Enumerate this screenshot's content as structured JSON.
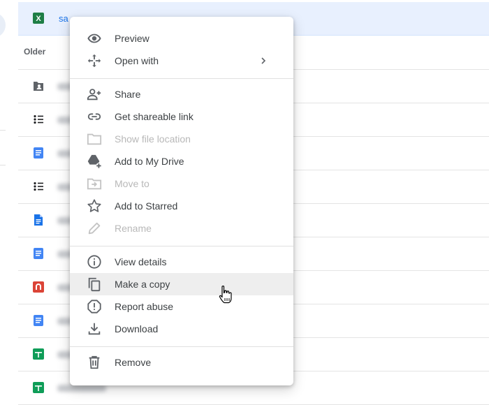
{
  "file_list": {
    "selected_row": {
      "name": "sa",
      "icon": "excel-icon",
      "icon_letter": "X",
      "color": "#1e7e45"
    },
    "section_label": "Older",
    "rows": [
      {
        "icon": "shared-folder-icon"
      },
      {
        "icon": "list-doc-icon"
      },
      {
        "icon": "google-docs-icon"
      },
      {
        "icon": "list-doc-icon"
      },
      {
        "icon": "google-docs-file-icon"
      },
      {
        "icon": "google-docs-icon"
      },
      {
        "icon": "pdf-red-icon"
      },
      {
        "icon": "google-docs-icon"
      },
      {
        "icon": "google-sheets-icon"
      },
      {
        "icon": "google-sheets-icon"
      }
    ]
  },
  "context_menu": {
    "items": [
      {
        "label": "Preview",
        "icon": "eye-icon",
        "enabled": true
      },
      {
        "label": "Open with",
        "icon": "move-arrows-icon",
        "enabled": true,
        "submenu": true
      },
      {
        "label": "Share",
        "icon": "person-add-icon",
        "enabled": true
      },
      {
        "label": "Get shareable link",
        "icon": "link-icon",
        "enabled": true
      },
      {
        "label": "Show file location",
        "icon": "folder-icon",
        "enabled": false
      },
      {
        "label": "Add to My Drive",
        "icon": "drive-add-icon",
        "enabled": true
      },
      {
        "label": "Move to",
        "icon": "move-to-folder-icon",
        "enabled": false
      },
      {
        "label": "Add to Starred",
        "icon": "star-icon",
        "enabled": true
      },
      {
        "label": "Rename",
        "icon": "pencil-icon",
        "enabled": false
      },
      {
        "label": "View details",
        "icon": "info-icon",
        "enabled": true
      },
      {
        "label": "Make a copy",
        "icon": "copy-icon",
        "enabled": true,
        "hovered": true
      },
      {
        "label": "Report abuse",
        "icon": "report-icon",
        "enabled": true
      },
      {
        "label": "Download",
        "icon": "download-icon",
        "enabled": true
      },
      {
        "label": "Remove",
        "icon": "trash-icon",
        "enabled": true
      }
    ]
  },
  "colors": {
    "selected_row_bg": "#e8f0fe",
    "link_blue": "#1a73e8",
    "docs_blue": "#4285f4",
    "sheets_green": "#0f9d58",
    "pdf_red": "#db4437",
    "menu_hover": "#eeeeee",
    "disabled_text": "#b8b8b8"
  }
}
